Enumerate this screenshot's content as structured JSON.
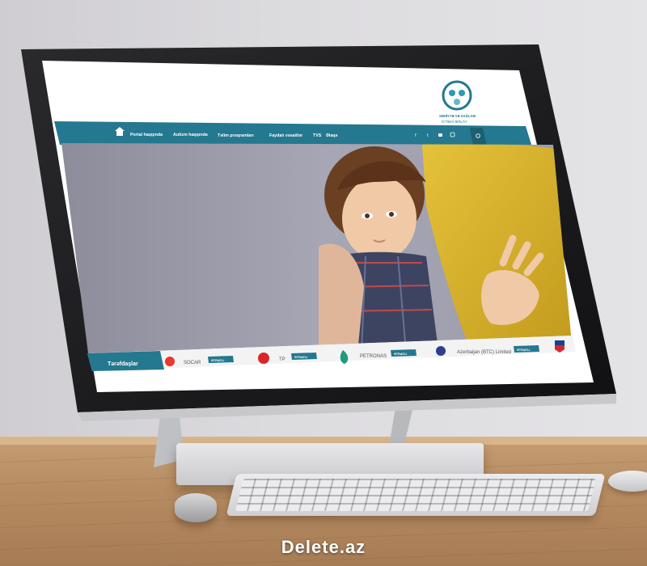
{
  "site": {
    "logo_text_line1": "SƏHİYYƏ VƏ SAĞLAM",
    "logo_text_line2": "İCTİMAİ BİRLİYİ"
  },
  "nav": {
    "items": [
      "Portal haqqında",
      "Autizm haqqında",
      "Təlim proqramları",
      "Faydalı vəsaitlər",
      "TVS",
      "Əlaqə"
    ]
  },
  "social_icons": [
    "facebook-icon",
    "twitter-icon",
    "youtube-icon",
    "instagram-icon",
    "search-icon"
  ],
  "partners": {
    "label": "Tərəfdaşlar",
    "button_label": "ƏTRAFLI",
    "items": [
      {
        "name": "SOCAR"
      },
      {
        "name": "TP"
      },
      {
        "name": "PETRONAS"
      },
      {
        "name": "Azerbaijan (BTC) Limited"
      }
    ]
  },
  "colors": {
    "accent": "#24788f",
    "accent_dark": "#1c5f72"
  },
  "watermark": "Delete.az"
}
